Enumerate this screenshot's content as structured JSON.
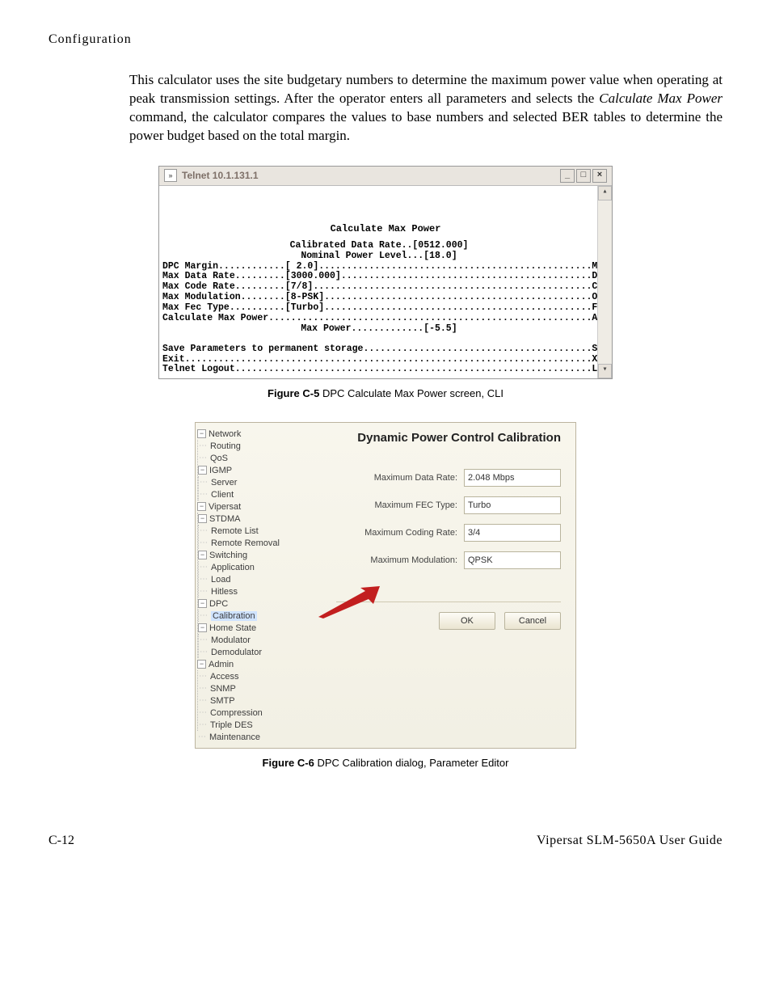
{
  "section_header": "Configuration",
  "body_paragraph_a": "This calculator uses the site budgetary numbers to determine the maximum power value when operating at peak transmission settings. After the operator enters all parameters and selects the ",
  "body_paragraph_italic": "Calculate Max Power",
  "body_paragraph_b": " command, the calculator compares the values to base numbers and selected BER tables to determine the power budget based on the total margin.",
  "telnet": {
    "title": "Telnet 10.1.131.1",
    "heading": "Calculate Max Power",
    "lines_block1": "Calibrated Data Rate..[0512.000]\nNominal Power Level...[18.0]\nDPC Margin............[ 2.0].................................................M\nMax Data Rate.........[3000.000].............................................D\nMax Code Rate.........[7/8]..................................................C\nMax Modulation........[8-PSK]................................................O\nMax Fec Type..........[Turbo]................................................F\nCalculate Max Power..........................................................A\nMax Power.............[-5.5]",
    "lines_block2": "Save Parameters to permanent storage.........................................S\nExit.........................................................................X\nTelnet Logout................................................................L"
  },
  "fig_c5_num": "Figure C-5",
  "fig_c5_txt": "   DPC Calculate Max Power screen, CLI",
  "pe": {
    "heading": "Dynamic Power Control Calibration",
    "tree": {
      "network": "Network",
      "routing": "Routing",
      "qos": "QoS",
      "igmp": "IGMP",
      "server": "Server",
      "client": "Client",
      "vipersat": "Vipersat",
      "stdma": "STDMA",
      "remote_list": "Remote List",
      "remote_removal": "Remote Removal",
      "switching": "Switching",
      "application": "Application",
      "load": "Load",
      "hitless": "Hitless",
      "dpc": "DPC",
      "calibration": "Calibration",
      "home_state": "Home State",
      "modulator": "Modulator",
      "demodulator": "Demodulator",
      "admin": "Admin",
      "access": "Access",
      "snmp": "SNMP",
      "smtp": "SMTP",
      "compression": "Compression",
      "triple_des": "Triple DES",
      "maintenance": "Maintenance"
    },
    "labels": {
      "max_data_rate": "Maximum Data Rate:",
      "max_fec_type": "Maximum FEC Type:",
      "max_coding_rate": "Maximum Coding Rate:",
      "max_modulation": "Maximum Modulation:"
    },
    "values": {
      "max_data_rate": "2.048 Mbps",
      "max_fec_type": "Turbo",
      "max_coding_rate": "3/4",
      "max_modulation": "QPSK"
    },
    "ok": "OK",
    "cancel": "Cancel"
  },
  "fig_c6_num": "Figure C-6",
  "fig_c6_txt": "   DPC Calibration dialog, Parameter Editor",
  "footer_left": "C-12",
  "footer_right": "Vipersat SLM-5650A User Guide"
}
